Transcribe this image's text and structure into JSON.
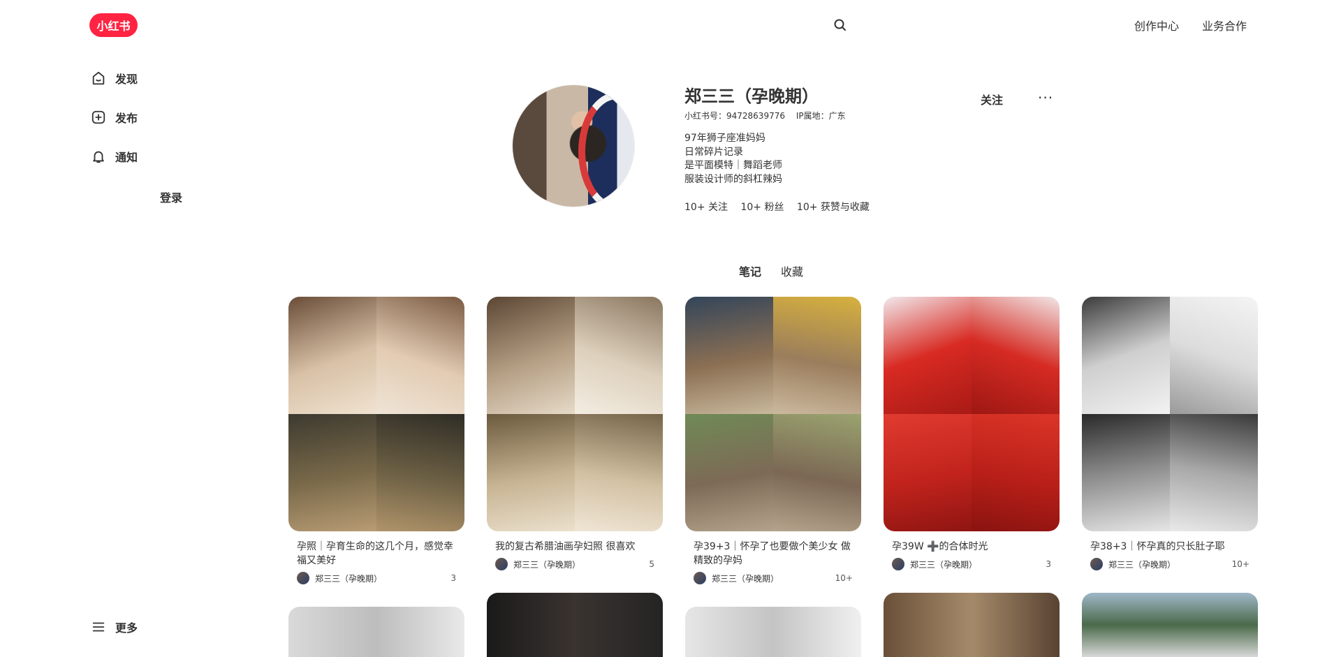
{
  "header": {
    "logo_text": "小红书",
    "links": [
      "创作中心",
      "业务合作"
    ]
  },
  "sidebar": {
    "items": [
      {
        "label": "发现",
        "icon": "home-icon"
      },
      {
        "label": "发布",
        "icon": "plus-square-icon"
      },
      {
        "label": "通知",
        "icon": "bell-icon"
      }
    ],
    "login": "登录",
    "more": "更多"
  },
  "profile": {
    "name": "郑三三（孕晚期）",
    "id_label": "小红书号：94728639776",
    "ip_label": "IP属地：广东",
    "bio": [
      "97年狮子座准妈妈",
      "日常碎片记录",
      "是平面模特｜舞蹈老师",
      "服装设计师的斜杠辣妈"
    ],
    "stats": [
      "10+ 关注",
      "10+ 粉丝",
      "10+ 获赞与收藏"
    ],
    "follow_label": "关注",
    "more_label": "···"
  },
  "tabs": [
    {
      "label": "笔记",
      "active": true
    },
    {
      "label": "收藏",
      "active": false
    }
  ],
  "notes": [
    {
      "title": "孕照｜孕育生命的这几个月，感觉幸福又美好",
      "author": "郑三三（孕晚期）",
      "likes": "3"
    },
    {
      "title": "我的复古希腊油画孕妇照 很喜欢",
      "author": "郑三三（孕晚期）",
      "likes": "5"
    },
    {
      "title": "孕39+3｜怀孕了也要做个美少女 做精致的孕妈",
      "author": "郑三三（孕晚期）",
      "likes": "10+"
    },
    {
      "title": "孕39W ➕的合体时光",
      "author": "郑三三（孕晚期）",
      "likes": "3"
    },
    {
      "title": "孕38+3｜怀孕真的只长肚子耶",
      "author": "郑三三（孕晚期）",
      "likes": "10+"
    }
  ],
  "colors": {
    "brand": "#ff2442",
    "text": "#333333"
  }
}
